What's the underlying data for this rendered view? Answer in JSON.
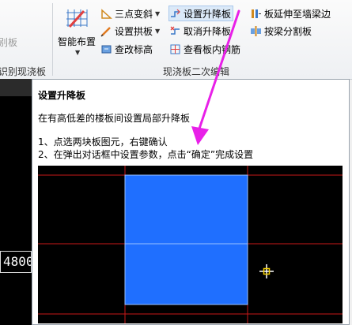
{
  "ribbon": {
    "partial_left_label": "别板",
    "partial_left_group": "识别现浇板",
    "smart_layout": "智能布置",
    "three_point": "三点变斜",
    "set_arch": "设置拱板",
    "check_elevation": "查改标高",
    "set_raise": "设置升降板",
    "cancel_raise": "取消升降板",
    "view_rebar": "查看板内钢筋",
    "extend_to_wall": "板延伸至墙梁边",
    "split_by_beam": "按梁分割板",
    "group_label": "现浇板二次编辑"
  },
  "tooltip": {
    "title": "设置升降板",
    "description": "在有高低差的楼板间设置局部升降板",
    "step1": "1、点选两块板图元，右键确认",
    "step2": "2、在弹出对话框中设置参数，点击“确定”完成设置"
  },
  "canvas": {
    "dimension_value": "4800"
  },
  "colors": {
    "arrow": "#e820e8",
    "slab": "#1f6fff",
    "grid": "#c81818",
    "highlight": "#dbe9f8"
  },
  "icons": {
    "smart_layout": "smart-layout-grid-icon",
    "three_point": "triangle-slope-icon",
    "set_arch": "arch-pencil-icon",
    "check_elevation": "elevation-icon",
    "set_raise": "raise-slab-icon",
    "cancel_raise": "cancel-raise-icon",
    "view_rebar": "rebar-view-icon",
    "extend_to_wall": "extend-icon",
    "split_by_beam": "split-icon",
    "cursor": "crosshair-cursor-icon"
  }
}
